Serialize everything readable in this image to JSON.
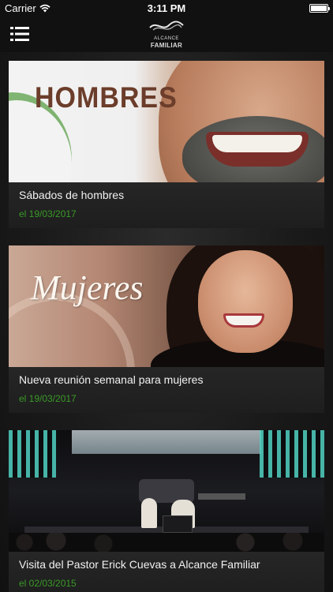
{
  "status_bar": {
    "carrier": "Carrier",
    "time": "3:11 PM",
    "battery_level": 1.0
  },
  "nav": {
    "menu_icon": "hamburger-menu-icon",
    "logo": {
      "line1": "ALCANCE",
      "line2": "FAMILIAR"
    }
  },
  "feed": {
    "items": [
      {
        "image_text": "HOMBRES",
        "title": "Sábados de hombres",
        "date": "el 19/03/2017"
      },
      {
        "image_text": "Mujeres",
        "title": "Nueva reunión semanal para mujeres",
        "date": "el 19/03/2017"
      },
      {
        "image_text": "",
        "title": "Visita del Pastor Erick Cuevas a Alcance Familiar",
        "date": "el 02/03/2015"
      }
    ]
  },
  "colors": {
    "date_green": "#3a9a27",
    "background": "#141414"
  }
}
